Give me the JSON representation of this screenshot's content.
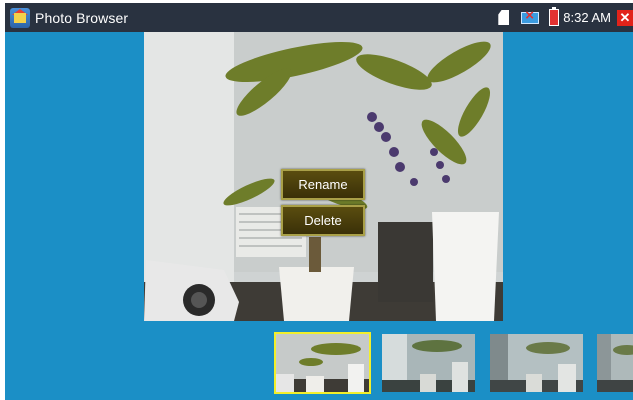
{
  "titlebar": {
    "app_title": "Photo Browser",
    "app_icon": "photo-browser-icon",
    "status": {
      "time": "8:32 AM",
      "icons": [
        "sd-card-icon",
        "network-disconnected-icon",
        "battery-low-icon"
      ]
    },
    "close_icon": "close-icon"
  },
  "context_menu": {
    "items": [
      {
        "label": "Rename"
      },
      {
        "label": "Delete"
      }
    ]
  },
  "thumbnails": [
    {
      "selected": true
    },
    {
      "selected": false
    },
    {
      "selected": false
    },
    {
      "selected": false
    }
  ],
  "colors": {
    "background": "#1b8fc6",
    "titlebar": "#293240",
    "menu_item": "#4a3f0c",
    "menu_border": "#a9a048",
    "selected_border": "#f2ef2b",
    "close": "#e2231a"
  }
}
